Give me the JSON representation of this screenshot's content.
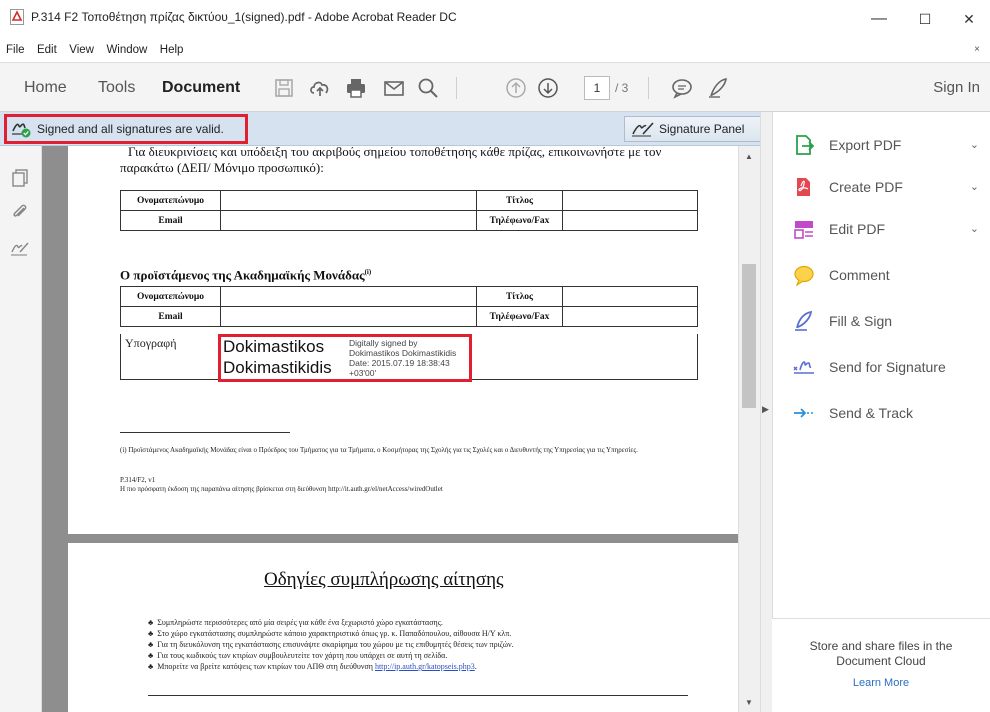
{
  "window": {
    "title": "P.314 F2 Τοποθέτηση πρίζας δικτύου_1(signed).pdf - Adobe Acrobat Reader DC",
    "minimize": "—",
    "maximize": "☐",
    "close": "✕"
  },
  "menu": {
    "items": [
      "File",
      "Edit",
      "View",
      "Window",
      "Help"
    ],
    "close_doc": "×"
  },
  "toolbar": {
    "tabs": [
      "Home",
      "Tools",
      "Document"
    ],
    "active_tab": "Document",
    "page_current": "1",
    "page_total": "/ 3",
    "sign_in": "Sign In"
  },
  "signature_bar": {
    "status": "Signed and all signatures are valid.",
    "panel_button": "Signature Panel",
    "colors": {
      "valid": "#2aa24a",
      "highlight": "#e02030"
    }
  },
  "document": {
    "intro_line1": "Για διευκρινίσεις και υπόδειξη του ακριβούς σημείου τοποθέτησης κάθε πρίζας, επικοινωνήστε με τον",
    "intro_line2": "παρακάτω (ΔΕΠ/ Μόνιμο προσωπικό):",
    "table1": [
      [
        "Ονοματεπώνυμο",
        "",
        "Τίτλος",
        ""
      ],
      [
        "Email",
        "",
        "Τηλέφωνο/Fax",
        ""
      ]
    ],
    "section_heading": "Ο προϊστάμενος της Ακαδημαϊκής Μονάδας",
    "section_sup": "(i)",
    "table2": [
      [
        "Ονοματεπώνυμο",
        "",
        "Τίτλος",
        ""
      ],
      [
        "Email",
        "",
        "Τηλέφωνο/Fax",
        ""
      ]
    ],
    "signature_label": "Υπογραφή",
    "signature": {
      "name_line1": "Dokimastikos",
      "name_line2": "Dokimastikidis",
      "info1": "Digitally signed by",
      "info2": "Dokimastikos Dokimastikidis",
      "info3": "Date: 2015.07.19 18:38:43",
      "info4": "+03'00'"
    },
    "footnote1": "(i) Προϊστάμενος Ακαδημαϊκής Μονάδας είναι ο Πρόεδρος του Τμήματος για τα Τμήματα, ο Κοσμήτορας της Σχολής για τις Σχολές και ο Διευθυντής της Υπηρεσίας για τις Υπηρεσίες.",
    "form_code": "P.314/F2, v1",
    "footnote2": "Η πιο πρόσφατη έκδοση της παραπάνω αίτησης βρίσκεται στη διεύθυνση http://it.auth.gr/el/netAccess/wiredOutlet",
    "page2_title": "Οδηγίες συμπλήρωσης αίτησης",
    "bullets": [
      "Συμπληρώστε περισσότερες από μία σειρές για κάθε ένα ξεχωριστό χώρο εγκατάστασης.",
      "Στο χώρο εγκατάστασης συμπληρώστε κάποιο χαρακτηριστικό όπως γρ. κ. Παπαδόπουλου, αίθουσα Η/Υ κλπ.",
      "Για τη διευκόλυνση της εγκατάστασης επισυνάψτε σκαρίφημα του χώρου με τις επιθυμητές θέσεις των πριζών.",
      "Για τους κωδικούς των κτιρίων συμβουλευτείτε τον χάρτη που υπάρχει σε αυτή τη σελίδα.",
      "Μπορείτε να βρείτε κατόψεις των κτιρίων του ΑΠΘ στη διεύθυνση"
    ],
    "bullet_link": "http://ip.auth.gr/katopseis.php3",
    "bullet_link_suffix": "."
  },
  "right_panel": {
    "items": [
      {
        "label": "Export PDF",
        "icon": "export-pdf-icon",
        "color": "#2aa24a",
        "chevron": true
      },
      {
        "label": "Create PDF",
        "icon": "create-pdf-icon",
        "color": "#e34850",
        "chevron": true
      },
      {
        "label": "Edit PDF",
        "icon": "edit-pdf-icon",
        "color": "#c04bc9",
        "chevron": true
      },
      {
        "label": "Comment",
        "icon": "comment-icon",
        "color": "#f0b400",
        "chevron": false
      },
      {
        "label": "Fill & Sign",
        "icon": "fill-sign-icon",
        "color": "#5a6fd6",
        "chevron": false
      },
      {
        "label": "Send for Signature",
        "icon": "send-signature-icon",
        "color": "#5a6fd6",
        "chevron": false
      },
      {
        "label": "Send & Track",
        "icon": "send-track-icon",
        "color": "#2b8fd6",
        "chevron": false
      }
    ],
    "cloud_message": "Store and share files in the Document Cloud",
    "learn_more": "Learn More"
  }
}
